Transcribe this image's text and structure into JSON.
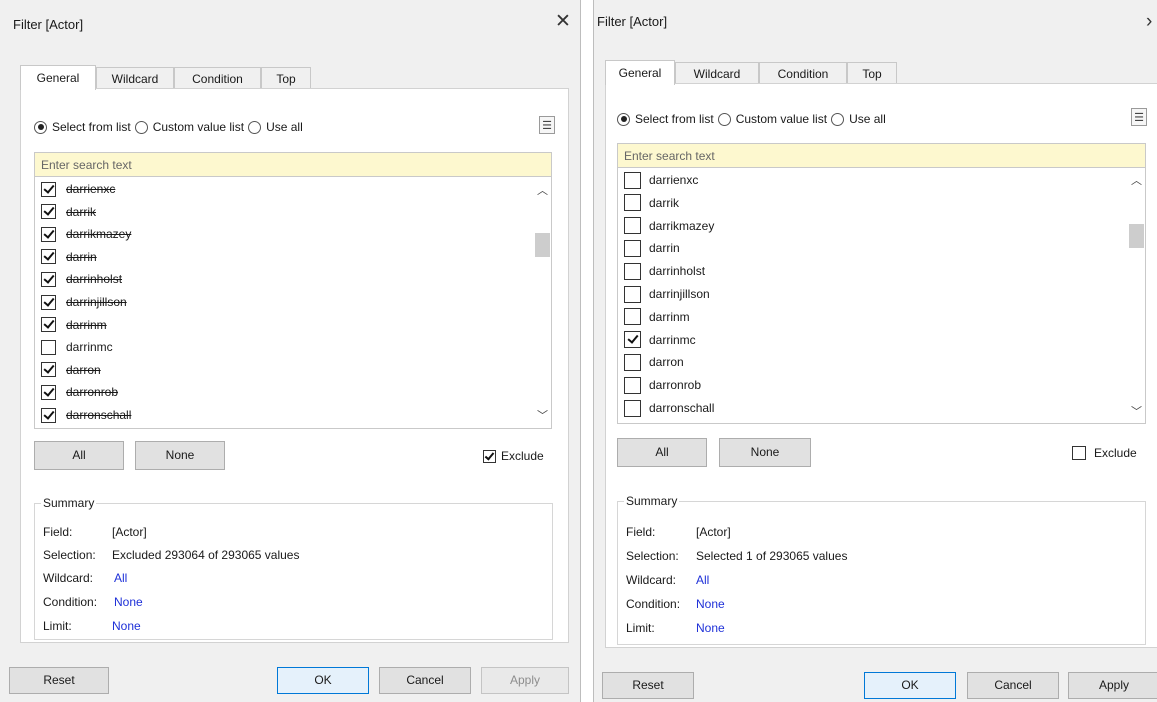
{
  "left": {
    "title": "Filter [Actor]",
    "tabs": [
      "General",
      "Wildcard",
      "Condition",
      "Top"
    ],
    "mode": {
      "selected": "Select from list",
      "options": [
        "Select from list",
        "Custom value list",
        "Use all"
      ]
    },
    "search_placeholder": "Enter search text",
    "items": [
      {
        "label": "darrienxc",
        "checked": true,
        "strike": true
      },
      {
        "label": "darrik",
        "checked": true,
        "strike": true
      },
      {
        "label": "darrikmazey",
        "checked": true,
        "strike": true
      },
      {
        "label": "darrin",
        "checked": true,
        "strike": true
      },
      {
        "label": "darrinholst",
        "checked": true,
        "strike": true
      },
      {
        "label": "darrinjillson",
        "checked": true,
        "strike": true
      },
      {
        "label": "darrinm",
        "checked": true,
        "strike": true
      },
      {
        "label": "darrinmc",
        "checked": false,
        "strike": false
      },
      {
        "label": "darron",
        "checked": true,
        "strike": true
      },
      {
        "label": "darronrob",
        "checked": true,
        "strike": true
      },
      {
        "label": "darronschall",
        "checked": true,
        "strike": true
      }
    ],
    "all_label": "All",
    "none_label": "None",
    "exclude_label": "Exclude",
    "exclude_checked": true,
    "summary": {
      "legend": "Summary",
      "field_key": "Field:",
      "field_val": "[Actor]",
      "selection_key": "Selection:",
      "selection_val": "Excluded 293064 of 293065 values",
      "wildcard_key": "Wildcard:",
      "wildcard_val": "All",
      "condition_key": "Condition:",
      "condition_val": "None",
      "limit_key": "Limit:",
      "limit_val": "None"
    },
    "reset_label": "Reset",
    "ok_label": "OK",
    "cancel_label": "Cancel",
    "apply_label": "Apply"
  },
  "right": {
    "title": "Filter [Actor]",
    "tabs": [
      "General",
      "Wildcard",
      "Condition",
      "Top"
    ],
    "mode": {
      "selected": "Select from list",
      "options": [
        "Select from list",
        "Custom value list",
        "Use all"
      ]
    },
    "search_placeholder": "Enter search text",
    "items": [
      {
        "label": "darrienxc",
        "checked": false,
        "strike": false
      },
      {
        "label": "darrik",
        "checked": false,
        "strike": false
      },
      {
        "label": "darrikmazey",
        "checked": false,
        "strike": false
      },
      {
        "label": "darrin",
        "checked": false,
        "strike": false
      },
      {
        "label": "darrinholst",
        "checked": false,
        "strike": false
      },
      {
        "label": "darrinjillson",
        "checked": false,
        "strike": false
      },
      {
        "label": "darrinm",
        "checked": false,
        "strike": false
      },
      {
        "label": "darrinmc",
        "checked": true,
        "strike": false
      },
      {
        "label": "darron",
        "checked": false,
        "strike": false
      },
      {
        "label": "darronrob",
        "checked": false,
        "strike": false
      },
      {
        "label": "darronschall",
        "checked": false,
        "strike": false
      }
    ],
    "all_label": "All",
    "none_label": "None",
    "exclude_label": "Exclude",
    "exclude_checked": false,
    "summary": {
      "legend": "Summary",
      "field_key": "Field:",
      "field_val": "[Actor]",
      "selection_key": "Selection:",
      "selection_val": "Selected 1 of 293065 values",
      "wildcard_key": "Wildcard:",
      "wildcard_val": "All",
      "condition_key": "Condition:",
      "condition_val": "None",
      "limit_key": "Limit:",
      "limit_val": "None"
    },
    "reset_label": "Reset",
    "ok_label": "OK",
    "cancel_label": "Cancel",
    "apply_label": "Apply"
  },
  "icons": {
    "close": "close-icon",
    "menu": "list-menu-icon",
    "scroll_up": "chevron-up-icon",
    "scroll_down": "chevron-down-icon"
  }
}
